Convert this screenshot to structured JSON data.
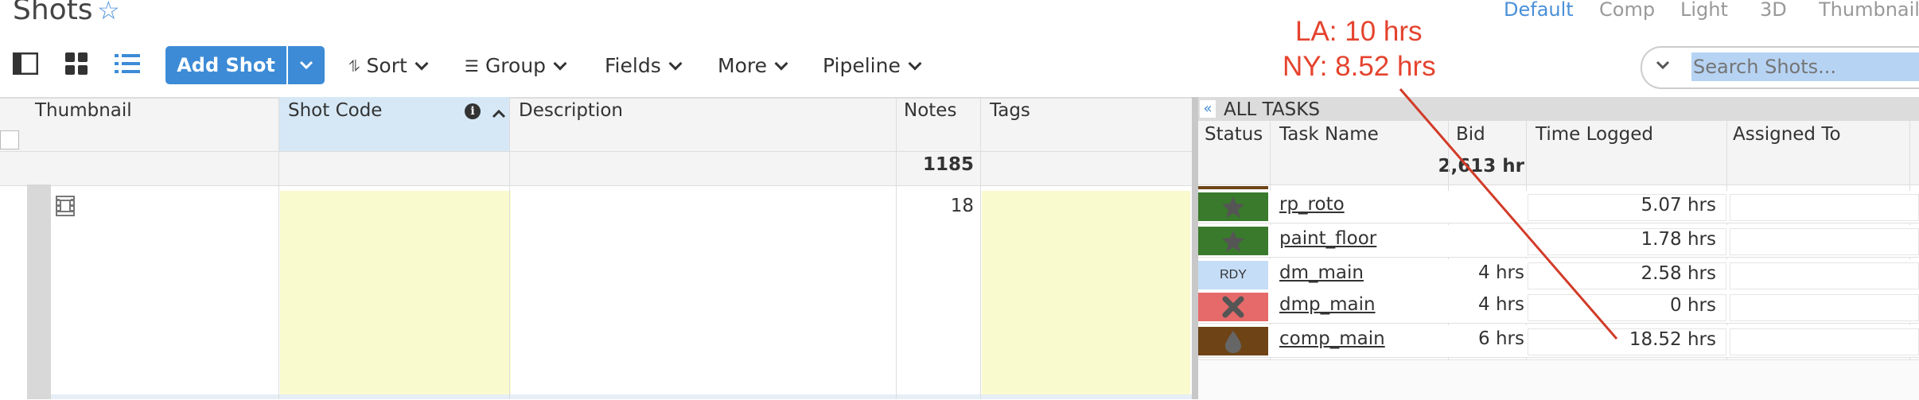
{
  "page": {
    "title": "Shots"
  },
  "view_tabs": [
    "Default",
    "Comp",
    "Light",
    "3D",
    "Thumbnail"
  ],
  "toolbar": {
    "add_label": "Add Shot",
    "sort": "Sort",
    "group": "Group",
    "fields": "Fields",
    "more": "More",
    "pipeline": "Pipeline"
  },
  "search": {
    "placeholder": "Search Shots..."
  },
  "annotation": {
    "line1": "LA: 10 hrs",
    "line2": "NY: 8.52 hrs"
  },
  "grid": {
    "columns": [
      "Thumbnail",
      "Shot Code",
      "Description",
      "Notes",
      "Tags"
    ],
    "summary_notes": "1185",
    "rows": [
      {
        "notes": "18"
      }
    ]
  },
  "tasks": {
    "header": "ALL TASKS",
    "columns": [
      "Status",
      "Task Name",
      "Bid",
      "Time Logged",
      "Assigned To"
    ],
    "summary_bid": "2,613 hr",
    "rows": [
      {
        "status": "star",
        "status_color": "#3a7a2c",
        "name": "rp_roto",
        "bid": "",
        "time": "5.07 hrs"
      },
      {
        "status": "star",
        "status_color": "#3a7a2c",
        "name": "paint_floor",
        "bid": "",
        "time": "1.78 hrs"
      },
      {
        "status": "RDY",
        "status_color": "#c6ddf7",
        "name": "dm_main",
        "bid": "4 hrs",
        "time": "2.58 hrs"
      },
      {
        "status": "x",
        "status_color": "#e66a6a",
        "name": "dmp_main",
        "bid": "4 hrs",
        "time": "0 hrs"
      },
      {
        "status": "drop",
        "status_color": "#6e4416",
        "name": "comp_main",
        "bid": "6 hrs",
        "time": "18.52 hrs"
      }
    ]
  },
  "colors": {
    "accent": "#3d8bd6",
    "annotation": "#e5432e",
    "highlight": "#fafacf"
  }
}
